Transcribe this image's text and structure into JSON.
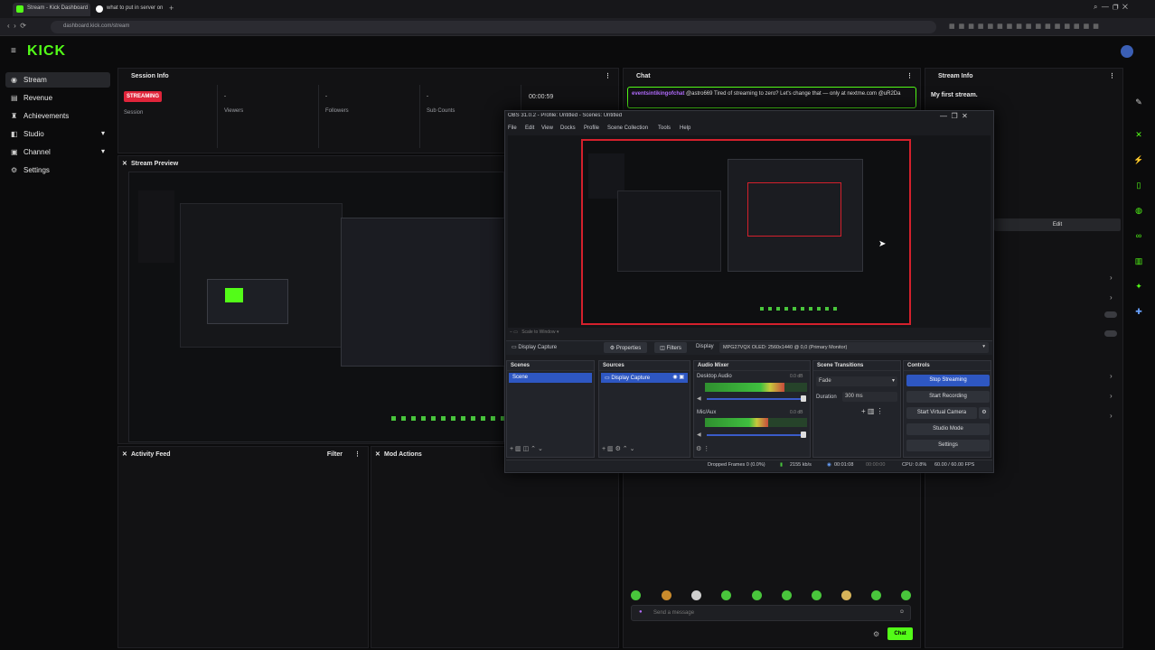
{
  "browser": {
    "tabs": [
      {
        "title": "Stream - Kick Dashboard",
        "color": "#53fc18"
      },
      {
        "title": "what to put in server on",
        "color": "#ffffff"
      }
    ],
    "url": "dashboard.kick.com/stream"
  },
  "kick": {
    "logo": "KICK",
    "nav": [
      {
        "label": "Stream",
        "icon": "broadcast-icon"
      },
      {
        "label": "Revenue",
        "icon": "money-icon"
      },
      {
        "label": "Achievements",
        "icon": "trophy-icon"
      },
      {
        "label": "Studio",
        "icon": "studio-icon"
      },
      {
        "label": "Channel",
        "icon": "channel-icon"
      },
      {
        "label": "Settings",
        "icon": "gear-icon"
      }
    ],
    "session_info": {
      "title": "Session Info",
      "badge": "STREAMING",
      "stats": [
        {
          "label": "Session",
          "value": ""
        },
        {
          "label": "Viewers",
          "value": "-"
        },
        {
          "label": "Followers",
          "value": "-"
        },
        {
          "label": "Sub Counts",
          "value": "-"
        },
        {
          "label": "",
          "value": "00:00:59"
        }
      ]
    },
    "chat": {
      "title": "Chat",
      "message_user": "eventsintikingofchat",
      "message_text": "@astro669 Tired of streaming to zero? Let's change that — only at nextme.com @uR2Da",
      "placeholder": "Send a message",
      "send_label": "Chat"
    },
    "stream_info": {
      "title": "Stream Info",
      "stream_title": "My first stream.",
      "edit_label": "Edit"
    },
    "stream_preview": {
      "title": "Stream Preview"
    },
    "activity_feed": {
      "title": "Activity Feed",
      "filter_label": "Filter"
    },
    "mod_actions": {
      "title": "Mod Actions"
    }
  },
  "obs": {
    "title": "OBS 31.0.2 - Profile: Untitled - Scenes: Untitled",
    "menu": [
      "File",
      "Edit",
      "View",
      "Docks",
      "Profile",
      "Scene Collection",
      "Tools",
      "Help"
    ],
    "source_bar": {
      "label": "Display Capture",
      "properties": "Properties",
      "filters": "Filters",
      "display_label": "Display",
      "display_value": "MPG27VQX OLED: 2560x1440 @ 0,0 (Primary Monitor)"
    },
    "scenes": {
      "title": "Scenes",
      "items": [
        "Scene"
      ]
    },
    "sources": {
      "title": "Sources",
      "items": [
        "Display Capture"
      ]
    },
    "mixer": {
      "title": "Audio Mixer",
      "channels": [
        {
          "name": "Desktop Audio",
          "db": "0.0 dB",
          "level": 0.78
        },
        {
          "name": "Mic/Aux",
          "db": "0.0 dB",
          "level": 0.62
        }
      ]
    },
    "transitions": {
      "title": "Scene Transitions",
      "type": "Fade",
      "duration_label": "Duration",
      "duration_value": "300 ms"
    },
    "controls": {
      "title": "Controls",
      "buttons": [
        "Stop Streaming",
        "Start Recording",
        "Start Virtual Camera",
        "Studio Mode",
        "Settings"
      ]
    },
    "status": {
      "dropped": "Dropped Frames 0 (0.0%)",
      "bitrate": "2155 kb/s",
      "stream_time": "00:01:08",
      "rec_time": "00:00:00",
      "cpu": "CPU: 0.8%",
      "fps": "60.00 / 60.00 FPS"
    }
  }
}
